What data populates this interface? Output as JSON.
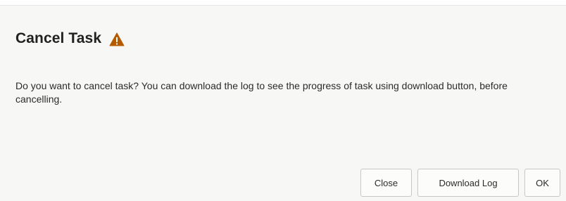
{
  "dialog": {
    "title": "Cancel Task",
    "title_icon": "warning-triangle-icon",
    "icon_color": "#b45a00",
    "message": "Do you want to cancel task? You can download the log to see the progress of task using download button, before cancelling.",
    "buttons": {
      "close": "Close",
      "download_log": "Download Log",
      "ok": "OK"
    }
  }
}
